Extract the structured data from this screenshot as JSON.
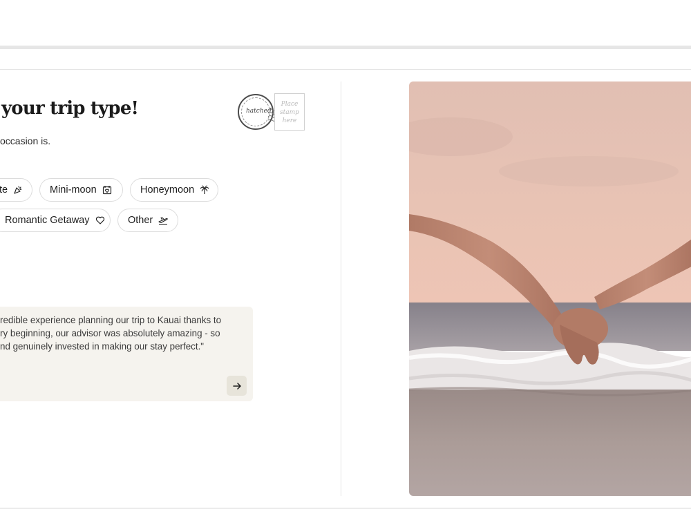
{
  "hero": {
    "title": "your trip type!",
    "subtitle": "occasion is."
  },
  "stamp": {
    "postmark_word": "hatched",
    "place_label_line1": "Place",
    "place_label_line2": "stamp",
    "place_label_line3": "here"
  },
  "trip_types": [
    {
      "label": "te",
      "icon": "party-popper-icon"
    },
    {
      "label": "Mini-moon",
      "icon": "calendar-heart-icon"
    },
    {
      "label": "Honeymoon",
      "icon": "palm-tree-icon"
    },
    {
      "label": "Romantic Getaway",
      "icon": "heart-icon"
    },
    {
      "label": "Other",
      "icon": "plane-icon"
    }
  ],
  "testimonial": {
    "line1": "redible experience planning our trip to Kauai thanks to",
    "line2": "ry beginning, our advisor was absolutely amazing - so",
    "line3": "nd genuinely invested in making our stay perfect.\"",
    "next_icon": "arrow-right-icon"
  },
  "photo": {
    "subject": "couple holding hands on beach"
  },
  "colors": {
    "testimonial_bg": "#f5f3ee",
    "chip_border": "#dcdcdc",
    "button_bg": "#e7e4da"
  }
}
